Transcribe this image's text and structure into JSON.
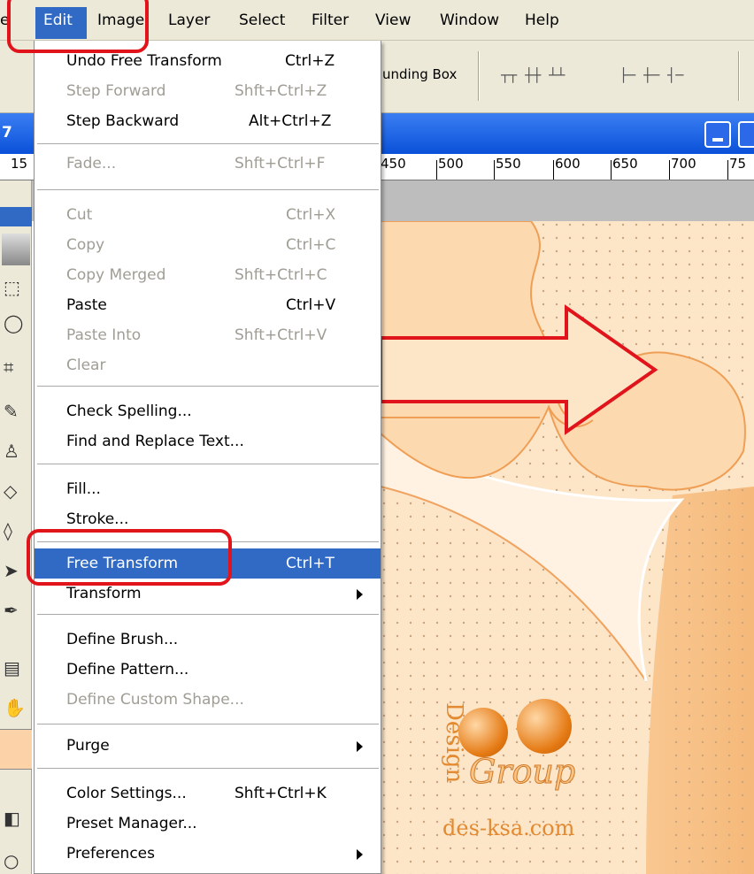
{
  "menubar": {
    "items": [
      "e",
      "Edit",
      "Image",
      "Layer",
      "Select",
      "Filter",
      "View",
      "Window",
      "Help"
    ]
  },
  "toolbar": {
    "bounding_box_label": "unding Box"
  },
  "document": {
    "zoom_partial": "7",
    "ruler_labels": [
      "15",
      "450",
      "500",
      "550",
      "600",
      "650",
      "700",
      "75"
    ]
  },
  "edit_menu": {
    "items": [
      {
        "label": "Undo Free Transform",
        "shortcut": "Ctrl+Z",
        "enabled": true
      },
      {
        "label": "Step Forward",
        "shortcut": "Shft+Ctrl+Z",
        "enabled": false
      },
      {
        "label": "Step Backward",
        "shortcut": "Alt+Ctrl+Z",
        "enabled": true
      },
      {
        "label": "Fade...",
        "shortcut": "Shft+Ctrl+F",
        "enabled": false
      },
      {
        "label": "Cut",
        "shortcut": "Ctrl+X",
        "enabled": false
      },
      {
        "label": "Copy",
        "shortcut": "Ctrl+C",
        "enabled": false
      },
      {
        "label": "Copy Merged",
        "shortcut": "Shft+Ctrl+C",
        "enabled": false
      },
      {
        "label": "Paste",
        "shortcut": "Ctrl+V",
        "enabled": true
      },
      {
        "label": "Paste Into",
        "shortcut": "Shft+Ctrl+V",
        "enabled": false
      },
      {
        "label": "Clear",
        "shortcut": "",
        "enabled": false
      },
      {
        "label": "Check Spelling...",
        "shortcut": "",
        "enabled": true
      },
      {
        "label": "Find and Replace Text...",
        "shortcut": "",
        "enabled": true
      },
      {
        "label": "Fill...",
        "shortcut": "",
        "enabled": true
      },
      {
        "label": "Stroke...",
        "shortcut": "",
        "enabled": true
      },
      {
        "label": "Free Transform",
        "shortcut": "Ctrl+T",
        "enabled": true,
        "selected": true
      },
      {
        "label": "Transform",
        "shortcut": "",
        "enabled": true,
        "submenu": true
      },
      {
        "label": "Define Brush...",
        "shortcut": "",
        "enabled": true
      },
      {
        "label": "Define Pattern...",
        "shortcut": "",
        "enabled": true
      },
      {
        "label": "Define Custom Shape...",
        "shortcut": "",
        "enabled": false
      },
      {
        "label": "Purge",
        "shortcut": "",
        "enabled": true,
        "submenu": true
      },
      {
        "label": "Color Settings...",
        "shortcut": "Shft+Ctrl+K",
        "enabled": true
      },
      {
        "label": "Preset Manager...",
        "shortcut": "",
        "enabled": true
      },
      {
        "label": "Preferences",
        "shortcut": "",
        "enabled": true,
        "submenu": true
      }
    ]
  },
  "watermark": {
    "site": "des-ksa.com",
    "word_design": "Design",
    "word_group": "Group"
  },
  "colors": {
    "menu_highlight": "#316ac5",
    "annotation_red": "#e0141a",
    "canvas_peach": "#fde5c8"
  }
}
